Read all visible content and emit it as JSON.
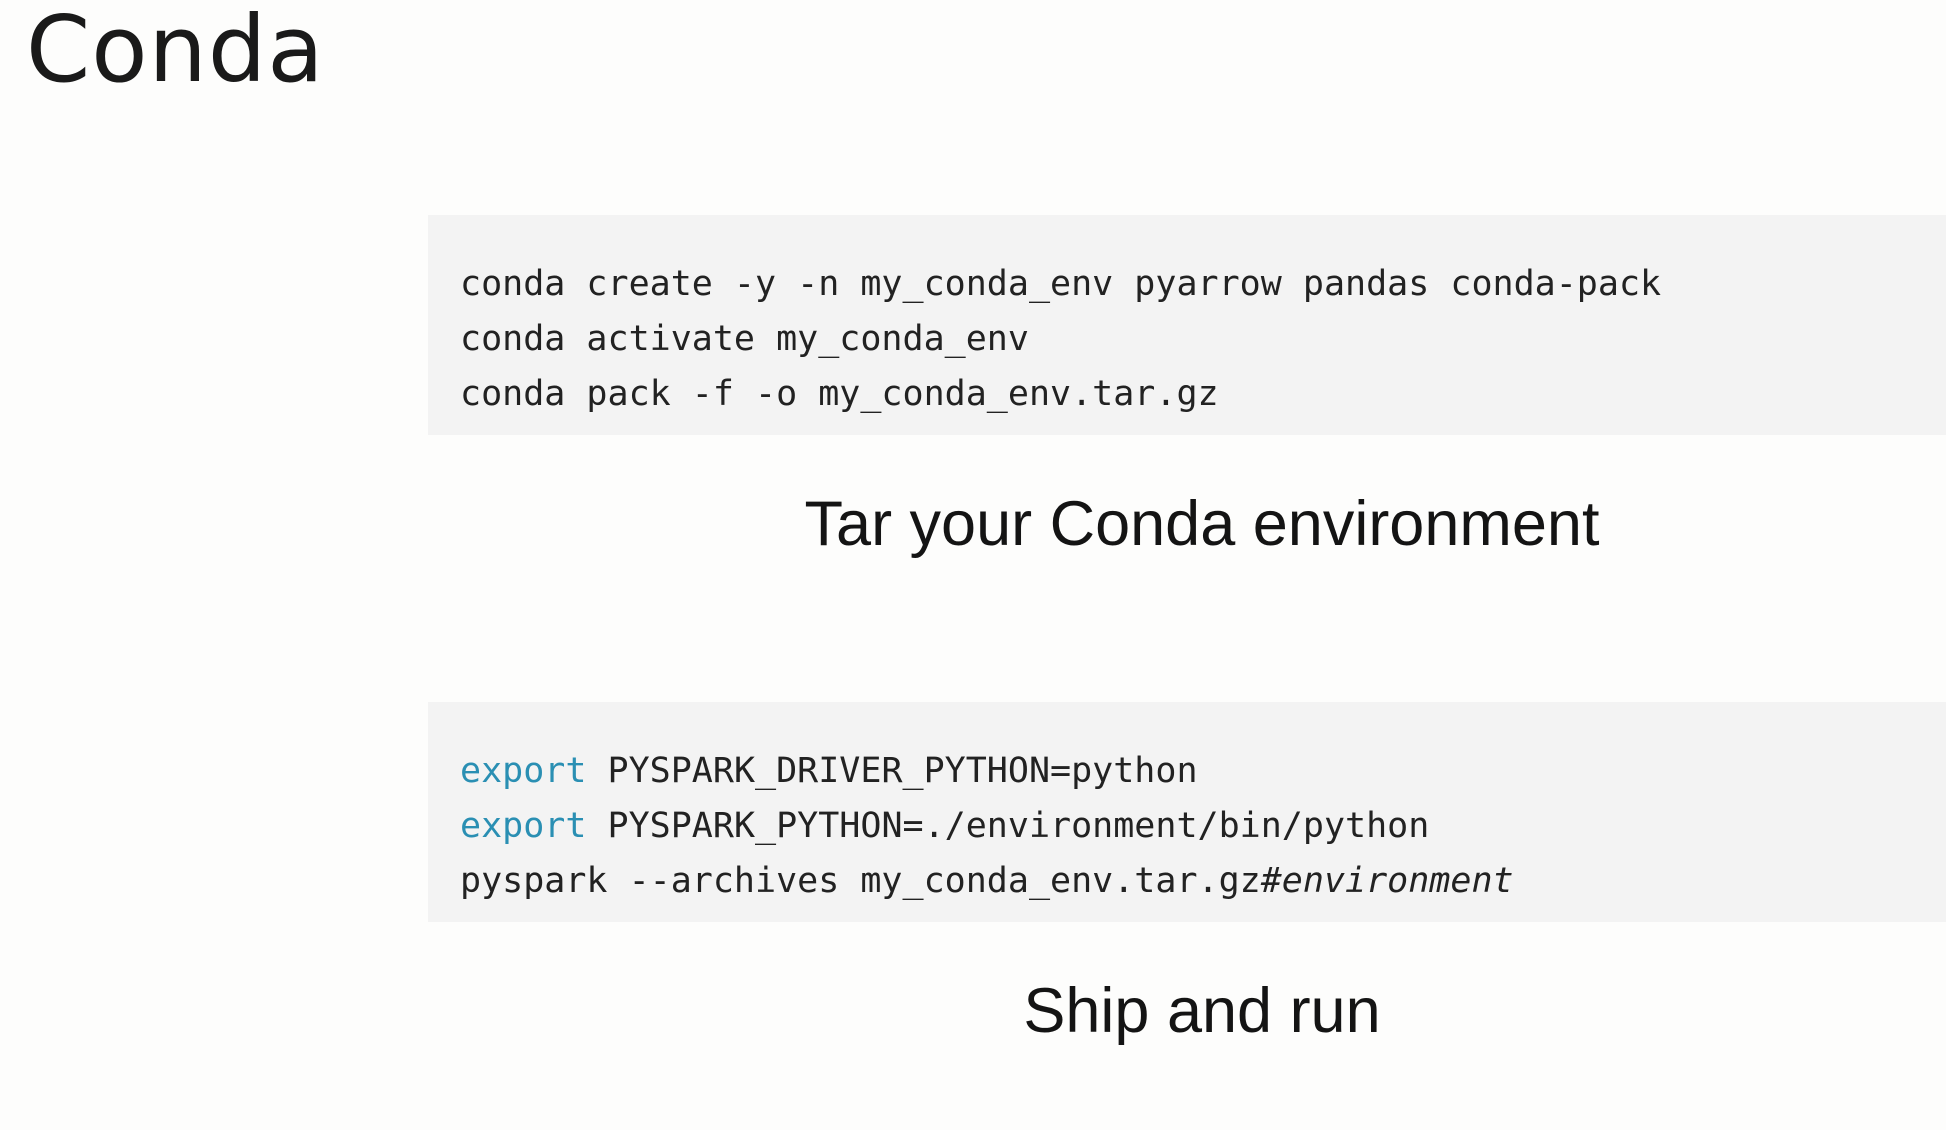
{
  "slide": {
    "title": "Conda"
  },
  "sections": [
    {
      "code_lines": [
        {
          "text": "conda create -y -n my_conda_env pyarrow pandas conda-pack"
        },
        {
          "text": "conda activate my_conda_env"
        },
        {
          "text": "conda pack -f -o my_conda_env.tar.gz"
        }
      ],
      "caption": "Tar your Conda environment"
    },
    {
      "code_lines": [
        {
          "keyword": "export",
          "rest": " PYSPARK_DRIVER_PYTHON=python"
        },
        {
          "keyword": "export",
          "rest": " PYSPARK_PYTHON=./environment/bin/python"
        },
        {
          "text": "pyspark --archives my_conda_env.tar.gz",
          "comment": "#environment"
        }
      ],
      "caption": "Ship and run"
    }
  ],
  "colors": {
    "background": "#fdfdfc",
    "code_background": "#f3f3f3",
    "keyword": "#2a8fb3",
    "text": "#141414"
  }
}
